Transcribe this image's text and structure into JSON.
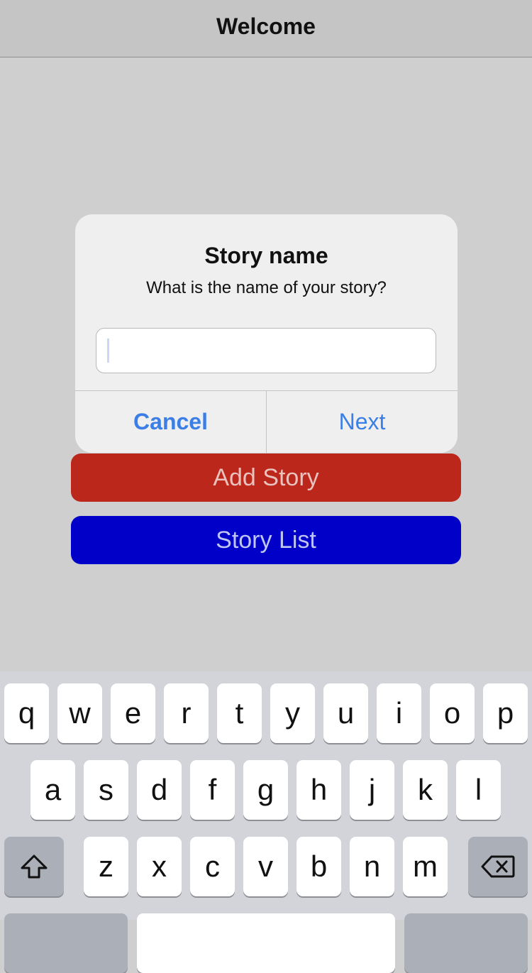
{
  "navbar": {
    "title": "Welcome"
  },
  "buttons": {
    "add_story": "Add Story",
    "story_list": "Story List"
  },
  "alert": {
    "title": "Story name",
    "message": "What is the name of your story?",
    "input_value": "",
    "cancel_label": "Cancel",
    "next_label": "Next"
  },
  "keyboard": {
    "row1": [
      "q",
      "w",
      "e",
      "r",
      "t",
      "y",
      "u",
      "i",
      "o",
      "p"
    ],
    "row2": [
      "a",
      "s",
      "d",
      "f",
      "g",
      "h",
      "j",
      "k",
      "l"
    ],
    "row3": [
      "z",
      "x",
      "c",
      "v",
      "b",
      "n",
      "m"
    ],
    "shift_icon": "shift-arrow-icon",
    "delete_icon": "backspace-icon"
  },
  "colors": {
    "add_story_bg": "#bb271b",
    "story_list_bg": "#0000c8",
    "alert_button_text": "#3b7fe6"
  }
}
